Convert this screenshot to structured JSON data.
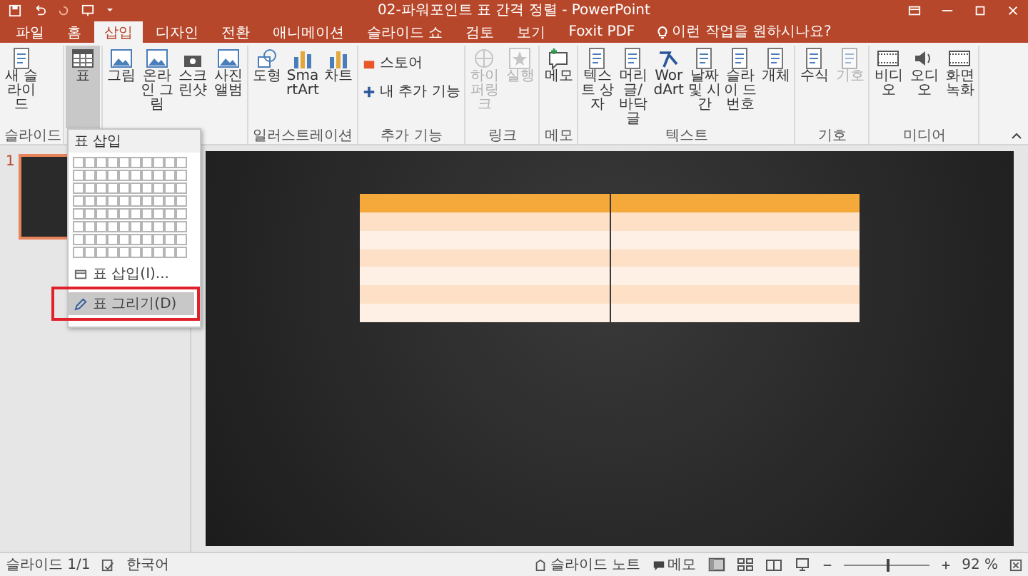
{
  "window": {
    "title": "02-파워포인트 표 간격 정렬 - PowerPoint"
  },
  "tabs": [
    {
      "label": "파일",
      "selected": false
    },
    {
      "label": "홈",
      "selected": false
    },
    {
      "label": "삽입",
      "selected": true
    },
    {
      "label": "디자인",
      "selected": false
    },
    {
      "label": "전환",
      "selected": false
    },
    {
      "label": "애니메이션",
      "selected": false
    },
    {
      "label": "슬라이드 쇼",
      "selected": false
    },
    {
      "label": "검토",
      "selected": false
    },
    {
      "label": "보기",
      "selected": false
    },
    {
      "label": "Foxit PDF",
      "selected": false
    }
  ],
  "tell_me": {
    "placeholder": "이런 작업을 원하시나요?"
  },
  "ribbon": {
    "groups": [
      {
        "label": "슬라이드",
        "buttons": [
          {
            "kind": "large",
            "label": "새 슬라이드",
            "disabled": false,
            "pressed": false
          }
        ]
      },
      {
        "buttons": [
          {
            "kind": "large",
            "label": "표",
            "disabled": false,
            "pressed": true
          }
        ]
      },
      {
        "buttons": [
          {
            "kind": "large",
            "label": "그림",
            "disabled": false,
            "pressed": false
          },
          {
            "kind": "large",
            "label": "온라인 그림",
            "disabled": false,
            "pressed": false
          },
          {
            "kind": "large",
            "label": "스크린샷",
            "disabled": false,
            "pressed": false
          },
          {
            "kind": "large",
            "label": "사진 앨범",
            "disabled": false,
            "pressed": false
          }
        ]
      },
      {
        "label": "일러스트레이션",
        "buttons": [
          {
            "kind": "large",
            "label": "도형",
            "disabled": false,
            "pressed": false
          },
          {
            "kind": "large",
            "label": "SmartArt",
            "disabled": false,
            "pressed": false
          },
          {
            "kind": "large",
            "label": "차트",
            "disabled": false,
            "pressed": false
          }
        ]
      },
      {
        "label": "추가 기능",
        "buttons": [
          {
            "kind": "small",
            "label": "스토어"
          },
          {
            "kind": "small",
            "label": "내 추가 기능"
          }
        ]
      },
      {
        "label": "링크",
        "buttons": [
          {
            "kind": "large",
            "label": "하이퍼링크",
            "disabled": true,
            "pressed": false
          },
          {
            "kind": "large",
            "label": "실행",
            "disabled": true,
            "pressed": false
          }
        ]
      },
      {
        "label": "메모",
        "buttons": [
          {
            "kind": "large",
            "label": "메모",
            "disabled": false,
            "pressed": false
          }
        ]
      },
      {
        "label": "텍스트",
        "buttons": [
          {
            "kind": "large",
            "label": "텍스트 상자",
            "disabled": false,
            "pressed": false
          },
          {
            "kind": "large",
            "label": "머리글/ 바닥글",
            "disabled": false,
            "pressed": false
          },
          {
            "kind": "large",
            "label": "WordArt",
            "disabled": false,
            "pressed": false
          },
          {
            "kind": "large",
            "label": "날짜 및 시간",
            "disabled": false,
            "pressed": false
          },
          {
            "kind": "large",
            "label": "슬라이 드 번호",
            "disabled": false,
            "pressed": false
          },
          {
            "kind": "large",
            "label": "개체",
            "disabled": false,
            "pressed": false
          }
        ]
      },
      {
        "label": "기호",
        "buttons": [
          {
            "kind": "large",
            "label": "수식",
            "disabled": false,
            "pressed": false
          },
          {
            "kind": "large",
            "label": "기호",
            "disabled": true,
            "pressed": false
          }
        ]
      },
      {
        "label": "미디어",
        "buttons": [
          {
            "kind": "large",
            "label": "비디오",
            "disabled": false,
            "pressed": false
          },
          {
            "kind": "large",
            "label": "오디오",
            "disabled": false,
            "pressed": false
          },
          {
            "kind": "large",
            "label": "화면 녹화",
            "disabled": false,
            "pressed": false
          }
        ]
      }
    ]
  },
  "table_menu": {
    "title": "표 삽입",
    "items": [
      {
        "label": "표 삽입(I)...",
        "selected": false
      },
      {
        "label": "표 그리기(D)",
        "selected": true
      }
    ]
  },
  "thumbnails": [
    {
      "number": "1",
      "selected": true
    }
  ],
  "status_bar": {
    "slide": "슬라이드 1/1",
    "language": "한국어",
    "notes": "슬라이드 노트",
    "comments": "메모",
    "zoom": {
      "level": 0.5,
      "reading": "92 %"
    }
  }
}
